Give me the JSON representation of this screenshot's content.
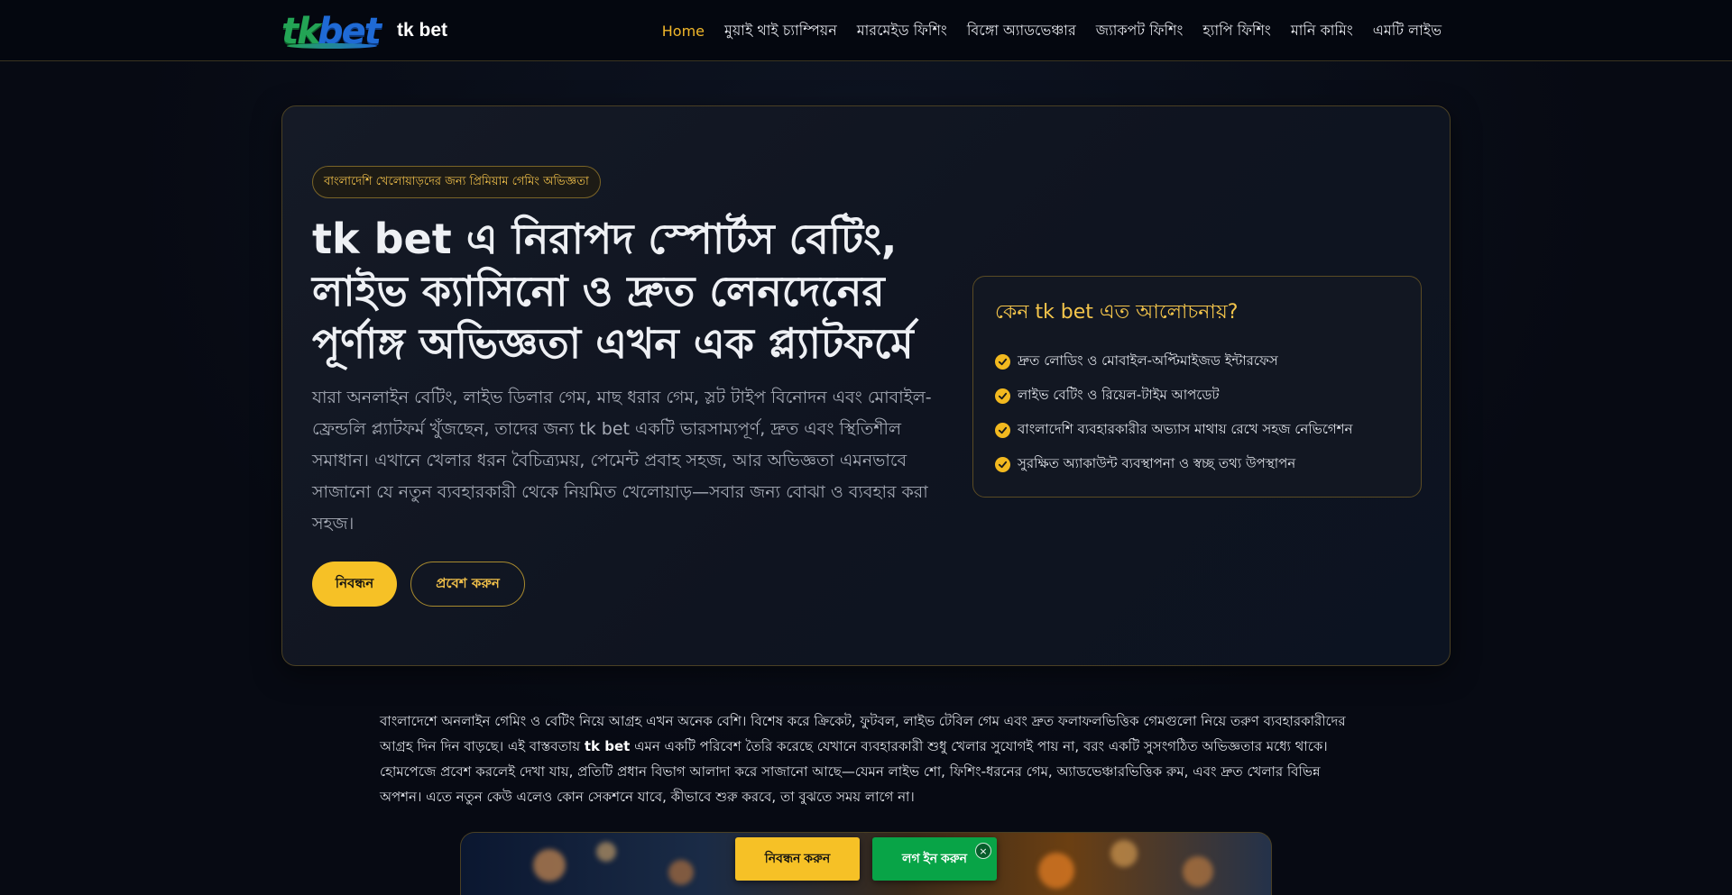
{
  "header": {
    "logo_tk": "tk",
    "logo_bet": "bet",
    "brand_name": "tk bet",
    "nav": [
      {
        "label": "Home",
        "active": true
      },
      {
        "label": "মুয়াই থাই চ্যাম্পিয়ন"
      },
      {
        "label": "মারমেইড ফিশিং"
      },
      {
        "label": "বিঙ্গো অ্যাডভেঞ্চার"
      },
      {
        "label": "জ্যাকপট ফিশিং"
      },
      {
        "label": "হ্যাপি ফিশিং"
      },
      {
        "label": "মানি কামিং"
      },
      {
        "label": "এমটি লাইভ"
      }
    ]
  },
  "hero": {
    "pill": "বাংলাদেশি খেলোয়াড়দের জন্য প্রিমিয়াম গেমিং অভিজ্ঞতা",
    "title": "tk bet এ নিরাপদ স্পোর্টস বেটিং, লাইভ ক্যাসিনো ও দ্রুত লেনদেনের পূর্ণাঙ্গ অভিজ্ঞতা এখন এক প্ল্যাটফর্মে",
    "lead": "যারা অনলাইন বেটিং, লাইভ ডিলার গেম, মাছ ধরার গেম, স্লট টাইপ বিনোদন এবং মোবাইল-ফ্রেন্ডলি প্ল্যাটফর্ম খুঁজছেন, তাদের জন্য tk bet একটি ভারসাম্যপূর্ণ, দ্রুত এবং স্থিতিশীল সমাধান। এখানে খেলার ধরন বৈচিত্র্যময়, পেমেন্ট প্রবাহ সহজ, আর অভিজ্ঞতা এমনভাবে সাজানো যে নতুন ব্যবহারকারী থেকে নিয়মিত খেলোয়াড়—সবার জন্য বোঝা ও ব্যবহার করা সহজ।",
    "register_label": "নিবন্ধন",
    "login_label": "প্রবেশ করুন",
    "why": {
      "title": "কেন tk bet এত আলোচনায়?",
      "items": [
        "দ্রুত লোডিং ও মোবাইল-অপ্টিমাইজড ইন্টারফেস",
        "লাইভ বেটিং ও রিয়েল-টাইম আপডেট",
        "বাংলাদেশি ব্যবহারকারীর অভ্যাস মাথায় রেখে সহজ নেভিগেশন",
        "সুরক্ষিত অ্যাকাউন্ট ব্যবস্থাপনা ও স্বচ্ছ তথ্য উপস্থাপন"
      ]
    }
  },
  "body": {
    "p1_before": "বাংলাদেশে অনলাইন গেমিং ও বেটিং নিয়ে আগ্রহ এখন অনেক বেশি। বিশেষ করে ক্রিকেট, ফুটবল, লাইভ টেবিল গেম এবং দ্রুত ফলাফলভিত্তিক গেমগুলো নিয়ে তরুণ ব্যবহারকারীদের আগ্রহ দিন দিন বাড়ছে। এই বাস্তবতায় ",
    "p1_bold": "tk bet",
    "p1_after": " এমন একটি পরিবেশ তৈরি করেছে যেখানে ব্যবহারকারী শুধু খেলার সুযোগই পায় না, বরং একটি সুসংগঠিত অভিজ্ঞতার মধ্যে থাকে। হোমপেজে প্রবেশ করলেই দেখা যায়, প্রতিটি প্রধান বিভাগ আলাদা করে সাজানো আছে—যেমন লাইভ শো, ফিশিং-ধরনের গেম, অ্যাডভেঞ্চারভিত্তিক রুম, এবং দ্রুত খেলার বিভিন্ন অপশন। এতে নতুন কেউ এলেও কোন সেকশনে যাবে, কীভাবে শুরু করবে, তা বুঝতে সময় লাগে না।"
  },
  "floating": {
    "register_label": "নিবন্ধন করুন",
    "login_label": "লগ ইন করুন",
    "close_label": "×"
  },
  "colors": {
    "accent": "#f6c126",
    "login_green": "#08a447",
    "background": "#070a13"
  }
}
